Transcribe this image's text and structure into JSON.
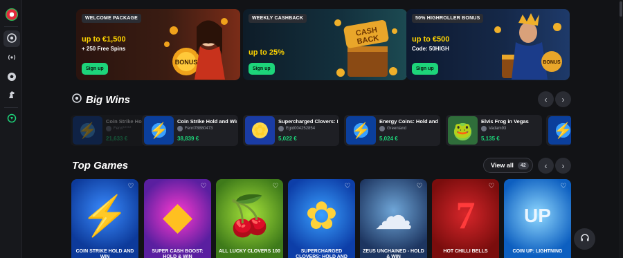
{
  "sidebar": {
    "logo": "roulette-logo-icon",
    "items": [
      {
        "icon": "chip-icon",
        "active": true
      },
      {
        "icon": "live-signal-icon",
        "active": false
      },
      {
        "icon": "soccer-ball-icon",
        "active": false
      },
      {
        "icon": "horse-icon",
        "active": false
      },
      {
        "icon": "esports-icon",
        "active": false
      }
    ]
  },
  "promos": [
    {
      "tag": "WELCOME PACKAGE",
      "title": "up to €1,500",
      "sub": "+ 250 Free Spins",
      "cta": "Sign up",
      "bg": "#2a1a12",
      "accent": "#ffb800"
    },
    {
      "tag": "WEEKLY CASHBACK",
      "title": "up to 25%",
      "sub": "",
      "cta": "Sign up",
      "bg": "#0f2230",
      "accent": "#ffb800"
    },
    {
      "tag": "50% HIGHROLLER BONUS",
      "title": "up to €500",
      "sub": "Code: 50HIGH",
      "cta": "Sign up",
      "bg": "#0f1d33",
      "accent": "#ffb800"
    }
  ],
  "big_wins": {
    "title": "Big Wins",
    "items": [
      {
        "name": "Coin Strike Hold and Win",
        "user": "Fenri*****",
        "amount": "21,633 €",
        "thumb": "bolt"
      },
      {
        "name": "Coin Strike Hold and Win",
        "user": "Fenri78880473",
        "amount": "38,839 €",
        "thumb": "bolt"
      },
      {
        "name": "Supercharged Clovers: Hold and Win",
        "user": "Egid004252854",
        "amount": "5,022 €",
        "thumb": "clover"
      },
      {
        "name": "Energy Coins: Hold and Win",
        "user": "Greenland",
        "amount": "5,024 €",
        "thumb": "bolt"
      },
      {
        "name": "Elvis Frog in Vegas",
        "user": "Vadam93",
        "amount": "5,135 €",
        "thumb": "frog"
      }
    ]
  },
  "top_games": {
    "title": "Top Games",
    "view_all": "View all",
    "count": "42",
    "games": [
      {
        "name": "COIN STRIKE HOLD AND WIN",
        "bg1": "#0d3a9a",
        "bg2": "#3a8cff",
        "glyph": "⚡",
        "color": "#ffd000"
      },
      {
        "name": "SUPER CASH BOOST: HOLD & WIN",
        "bg1": "#5a1fa0",
        "bg2": "#ff3ad0",
        "glyph": "◆",
        "color": "#ffc020"
      },
      {
        "name": "ALL LUCKY CLOVERS 100",
        "bg1": "#3e7a1a",
        "bg2": "#a6e23a",
        "glyph": "🍒",
        "color": "#e8202a"
      },
      {
        "name": "SUPERCHARGED CLOVERS: HOLD AND WIN",
        "bg1": "#0d3ea8",
        "bg2": "#3aa0ff",
        "glyph": "✿",
        "color": "#ffd23a"
      },
      {
        "name": "ZEUS UNCHAINED - HOLD & WIN",
        "bg1": "#1d3560",
        "bg2": "#6fa6d8",
        "glyph": "☁",
        "color": "#e7eef8"
      },
      {
        "name": "HOT CHILLI BELLS",
        "bg1": "#7a0d0d",
        "bg2": "#d6262a",
        "glyph": "7",
        "color": "#ff3b3b"
      },
      {
        "name": "COIN UP: LIGHTNING",
        "bg1": "#0d5fc0",
        "bg2": "#8fd8ff",
        "glyph": "UP",
        "color": "#eaf6ff"
      }
    ]
  },
  "icons": {
    "nav_prev": "chevron-left-icon",
    "nav_next": "chevron-right-icon",
    "heart": "heart-icon",
    "help": "headset-icon"
  }
}
